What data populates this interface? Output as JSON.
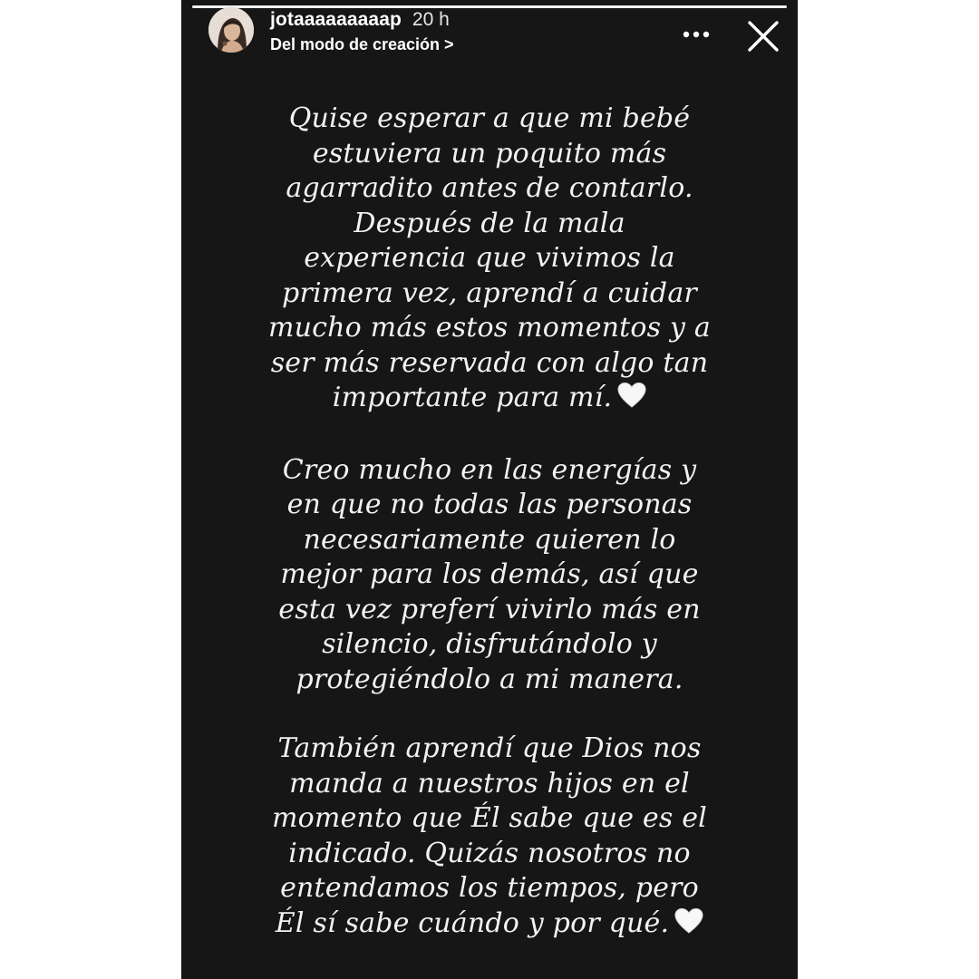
{
  "story": {
    "progress": 1.0,
    "header": {
      "username": "jotaaaaaaaaap",
      "time": "20 h",
      "subtitle": "Del modo de creación >"
    },
    "icons": {
      "more": "more-dots-icon",
      "close": "close-icon",
      "heart": "white-heart-emoji"
    },
    "colors": {
      "background": "#161616",
      "text": "#f2f2f2"
    },
    "paragraphs": [
      {
        "lines": [
          "Quise esperar a que mi bebé",
          "estuviera un poquito más",
          "agarradito antes de contarlo.",
          "Después de la mala",
          "experiencia que vivimos la",
          "primera vez, aprendí a cuidar",
          "mucho más estos momentos y a",
          "ser más reservada con algo tan",
          "importante para mí."
        ],
        "ends_with_heart": true
      },
      {
        "lines": [
          "Creo mucho en las energías y",
          "en que no todas las personas",
          "necesariamente quieren lo",
          "mejor para los demás, así que",
          "esta vez preferí vivirlo más en",
          "silencio, disfrutándolo y",
          "protegiéndolo a mi manera."
        ],
        "ends_with_heart": false
      },
      {
        "lines": [
          "También aprendí que Dios nos",
          "manda a nuestros hijos en el",
          "momento que Él sabe que es el",
          "indicado. Quizás nosotros no",
          "entendamos los tiempos, pero",
          "Él sí sabe cuándo y por qué."
        ],
        "ends_with_heart": true
      }
    ]
  }
}
